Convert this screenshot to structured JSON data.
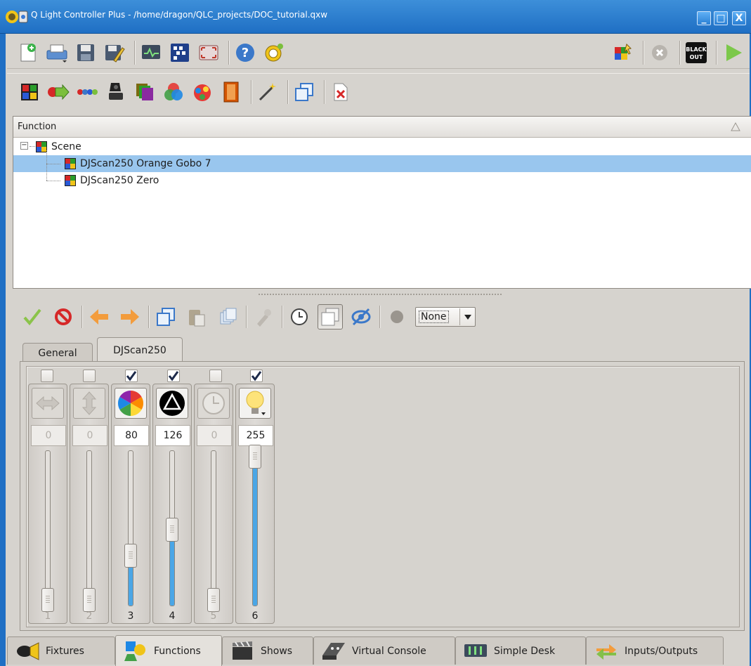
{
  "window": {
    "title": "Q Light Controller Plus - /home/dragon/QLC_projects/DOC_tutorial.qxw",
    "minimize": "_",
    "maximize": "□",
    "close": "X"
  },
  "main_toolbar": {
    "icons": [
      "new-project-icon",
      "open-project-icon",
      "save-project-icon",
      "save-as-icon",
      "monitor-icon",
      "address-tool-icon",
      "fullscreen-icon",
      "help-icon",
      "about-icon"
    ],
    "right_icons": [
      "live-edit-icon",
      "stop-all-icon",
      "blackout-icon",
      "operate-mode-icon"
    ],
    "blackout_label_top": "BLACK",
    "blackout_label_bottom": "OUT"
  },
  "function_toolbar": {
    "icons": [
      "new-scene-icon",
      "new-chaser-icon",
      "new-sequence-icon",
      "new-efx-icon",
      "new-collection-icon",
      "new-rgb-matrix-icon",
      "new-script-icon",
      "new-show-icon",
      "function-wizard-icon",
      "clone-function-icon",
      "delete-function-icon"
    ]
  },
  "function_tree": {
    "header": "Function",
    "folder": "Scene",
    "items": [
      {
        "label": "DJScan250 Orange Gobo 7",
        "selected": true
      },
      {
        "label": "DJScan250 Zero",
        "selected": false
      }
    ]
  },
  "editor_toolbar": {
    "combo_value": "None"
  },
  "tabs": [
    {
      "label": "General",
      "active": false
    },
    {
      "label": "DJScan250",
      "active": true
    }
  ],
  "channels": [
    {
      "number": "1",
      "value": "0",
      "enabled": false,
      "checked": false,
      "level_fraction": 0,
      "icon": "pan-icon"
    },
    {
      "number": "2",
      "value": "0",
      "enabled": false,
      "checked": false,
      "level_fraction": 0,
      "icon": "tilt-icon"
    },
    {
      "number": "3",
      "value": "80",
      "enabled": true,
      "checked": true,
      "level_fraction": 0.31,
      "icon": "color-wheel-icon"
    },
    {
      "number": "4",
      "value": "126",
      "enabled": true,
      "checked": true,
      "level_fraction": 0.49,
      "icon": "gobo-icon"
    },
    {
      "number": "5",
      "value": "0",
      "enabled": false,
      "checked": false,
      "level_fraction": 0,
      "icon": "speed-icon"
    },
    {
      "number": "6",
      "value": "255",
      "enabled": true,
      "checked": true,
      "level_fraction": 1.0,
      "icon": "intensity-icon"
    }
  ],
  "bottom_tabs": [
    {
      "label": "Fixtures",
      "active": false,
      "icon": "fixtures-icon"
    },
    {
      "label": "Functions",
      "active": true,
      "icon": "functions-icon"
    },
    {
      "label": "Shows",
      "active": false,
      "icon": "shows-icon"
    },
    {
      "label": "Virtual Console",
      "active": false,
      "icon": "virtual-console-icon"
    },
    {
      "label": "Simple Desk",
      "active": false,
      "icon": "simple-desk-icon"
    },
    {
      "label": "Inputs/Outputs",
      "active": false,
      "icon": "inputs-outputs-icon"
    }
  ],
  "colors": {
    "titlebar": "#1f6fc4",
    "selection": "#99c6ee",
    "slider_fill": "#4aa6e6"
  }
}
